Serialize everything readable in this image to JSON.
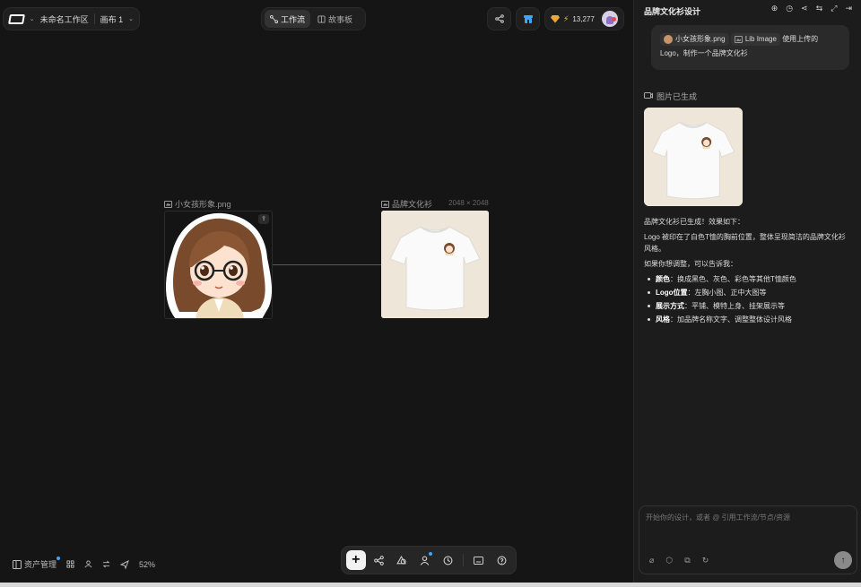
{
  "header": {
    "workspace_name": "未命名工作区",
    "canvas_name": "画布 1",
    "mode_workflow": "工作流",
    "mode_storyboard": "故事板",
    "credits": "13,277"
  },
  "canvas": {
    "node_source": {
      "title": "小女孩形象.png"
    },
    "node_output": {
      "title": "品牌文化衫",
      "dimensions": "2048 × 2048"
    },
    "zoom": "52%",
    "asset_manager_label": "资产管理"
  },
  "panel": {
    "title": "品牌文化衫设计",
    "user_message": {
      "chip_file": "小女孩形象.png",
      "chip_lib": "Lib Image",
      "text_after_chips": "使用上传的",
      "text_line2": "Logo，制作一个品牌文化衫"
    },
    "generated_label": "图片已生成",
    "reply": {
      "intro": "品牌文化衫已生成！效果如下：",
      "desc": "Logo 被印在了白色T恤的胸前位置，整体呈现简洁的品牌文化衫风格。",
      "prompt": "如果你想调整，可以告诉我：",
      "items": [
        {
          "key": "颜色",
          "value": "：换成黑色、灰色、彩色等其他T恤颜色"
        },
        {
          "key": "Logo位置",
          "value": "：左胸小图、正中大图等"
        },
        {
          "key": "展示方式",
          "value": "：平铺、模特上身、挂架展示等"
        },
        {
          "key": "风格",
          "value": "：加品牌名称文字、调整整体设计风格"
        }
      ]
    },
    "input_placeholder": "开始你的设计，或者 @ 引用工作流/节点/资源"
  },
  "icons": {
    "header_right": [
      "share-icon",
      "store-icon"
    ],
    "panel_header": [
      "new-chat-icon",
      "history-icon",
      "share-icon",
      "settings-icon",
      "collapse-icon",
      "exit-icon"
    ],
    "toolbar": [
      "plus-icon",
      "workflow-icon",
      "shapes-icon",
      "person-icon",
      "history-icon",
      "keyboard-icon",
      "help-icon"
    ],
    "input_tools": [
      "attach-icon",
      "box-icon",
      "upload-icon",
      "refresh-icon"
    ]
  }
}
